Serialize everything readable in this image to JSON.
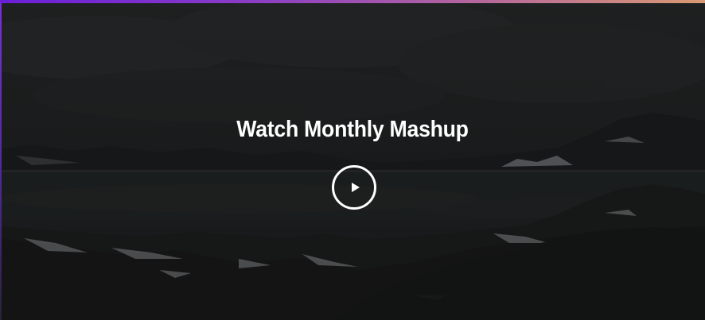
{
  "hero": {
    "title": "Watch Monthly Mashup",
    "play_icon": "play-icon",
    "accent_colors": [
      "#6a1fd8",
      "#b86a9a",
      "#d99a72"
    ]
  }
}
